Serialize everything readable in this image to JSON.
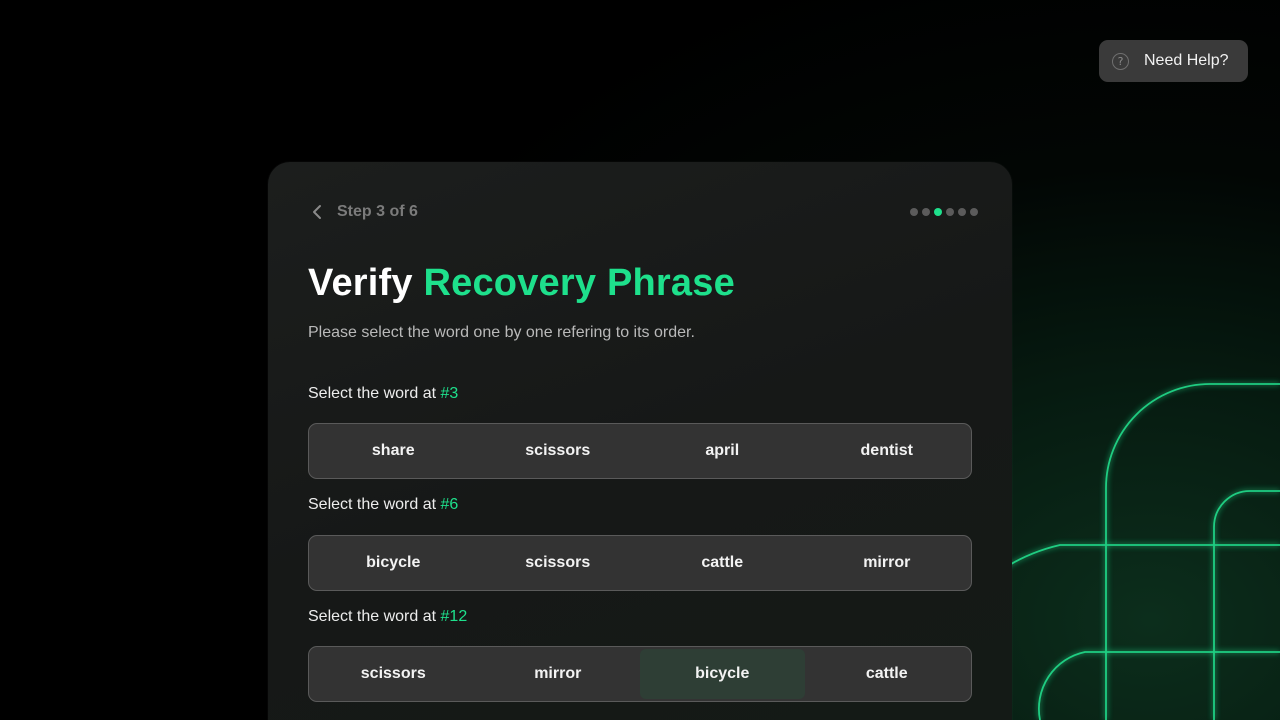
{
  "help": {
    "label": "Need Help?",
    "icon": "question-circle-icon"
  },
  "step": {
    "text": "Step 3 of 6",
    "total": 6,
    "current": 3
  },
  "title": {
    "prefix": "Verify ",
    "accent": "Recovery Phrase"
  },
  "subtitle": "Please select the word one by one refering to its order.",
  "questions": [
    {
      "prefix": "Select the word at ",
      "number": "#3",
      "options": [
        "share",
        "scissors",
        "april",
        "dentist"
      ],
      "selected": null
    },
    {
      "prefix": "Select the word at ",
      "number": "#6",
      "options": [
        "bicycle",
        "scissors",
        "cattle",
        "mirror"
      ],
      "selected": null
    },
    {
      "prefix": "Select the word at ",
      "number": "#12",
      "options": [
        "scissors",
        "mirror",
        "bicycle",
        "cattle"
      ],
      "selected": "bicycle"
    }
  ],
  "colors": {
    "accent": "#1ee08c",
    "card": "#1a1c1b",
    "option_bg": "#333333",
    "selected_bg": "#2e3e35"
  }
}
